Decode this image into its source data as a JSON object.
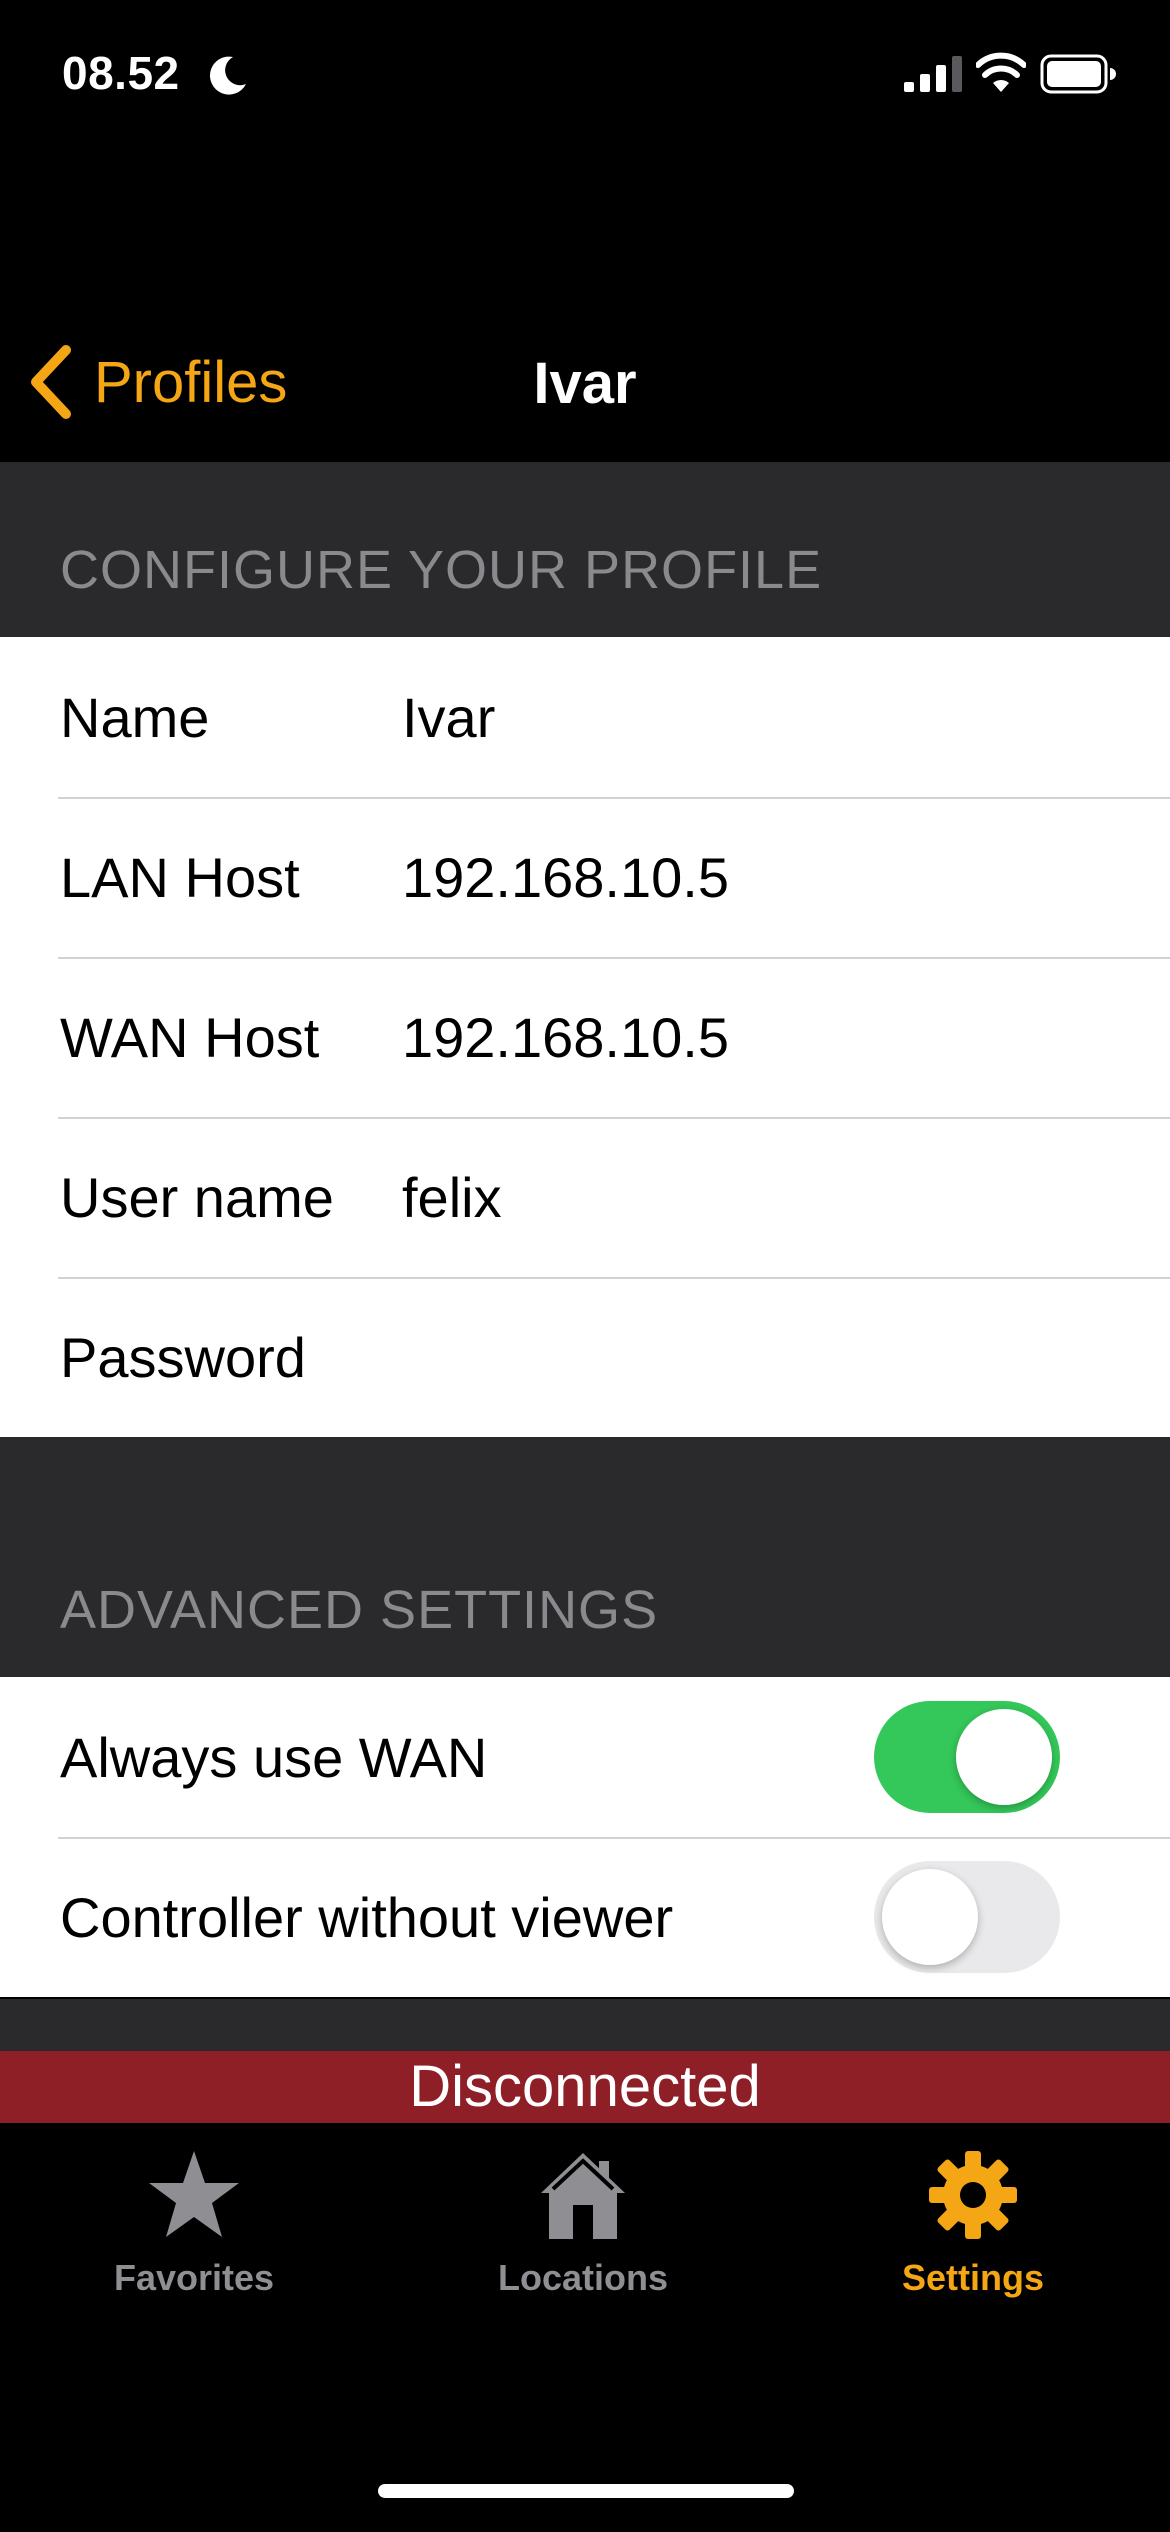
{
  "status_bar": {
    "time": "08.52",
    "icons": [
      "moon-icon",
      "cellular-signal-icon",
      "wifi-icon",
      "battery-icon"
    ]
  },
  "nav": {
    "back_label": "Profiles",
    "title": "Ivar"
  },
  "colors": {
    "accent": "#f5a614",
    "toggle_on": "#34c759",
    "banner": "#8e1f27",
    "section_bg": "#2a2a2c"
  },
  "profile_section": {
    "header": "CONFIGURE YOUR PROFILE",
    "rows": [
      {
        "label": "Name",
        "value": "Ivar"
      },
      {
        "label": "LAN Host",
        "value": "192.168.10.5"
      },
      {
        "label": "WAN Host",
        "value": "192.168.10.5"
      },
      {
        "label": "User name",
        "value": "felix"
      },
      {
        "label": "Password",
        "value": ""
      }
    ]
  },
  "advanced_section": {
    "header": "ADVANCED SETTINGS",
    "rows": [
      {
        "label": "Always use WAN",
        "enabled": true
      },
      {
        "label": "Controller without viewer",
        "enabled": false
      }
    ]
  },
  "connection_status": "Disconnected",
  "tab_bar": {
    "tabs": [
      {
        "label": "Favorites",
        "icon": "star-icon",
        "active": false
      },
      {
        "label": "Locations",
        "icon": "home-icon",
        "active": false
      },
      {
        "label": "Settings",
        "icon": "gear-icon",
        "active": true
      }
    ]
  }
}
